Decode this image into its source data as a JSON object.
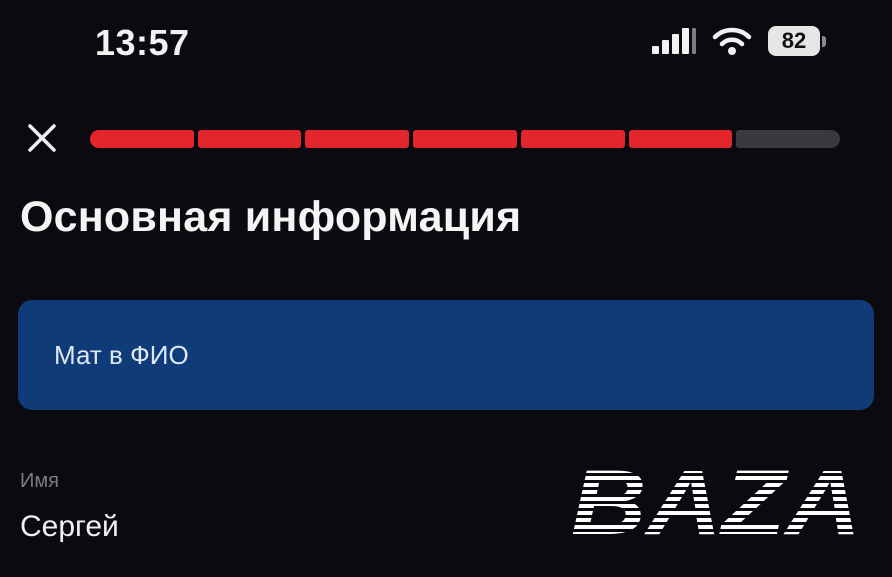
{
  "status_bar": {
    "time": "13:57",
    "battery": "82",
    "icons": [
      "signal-icon",
      "wifi-icon",
      "battery-icon"
    ]
  },
  "header": {
    "close_icon": "close-icon",
    "progress": {
      "total_steps": 7,
      "completed_steps": 6
    },
    "title": "Основная информация"
  },
  "banner": {
    "text": "Мат в ФИО"
  },
  "field": {
    "label": "Имя",
    "value": "Сергей"
  },
  "watermark": {
    "text": "BAZA"
  },
  "colors": {
    "background": "#0b0a10",
    "progress_active": "#e3262b",
    "progress_inactive": "#3a3a3e",
    "banner": "#0f3b78"
  }
}
